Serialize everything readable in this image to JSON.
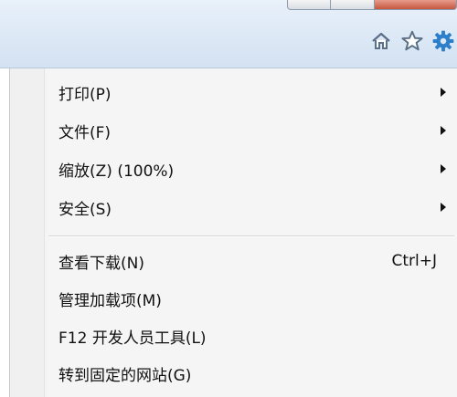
{
  "menu": {
    "items": [
      {
        "label": "打印(P)",
        "submenu": true
      },
      {
        "label": "文件(F)",
        "submenu": true
      },
      {
        "label": "缩放(Z) (100%)",
        "submenu": true
      },
      {
        "label": "安全(S)",
        "submenu": true
      }
    ],
    "items2": [
      {
        "label": "查看下载(N)",
        "shortcut": "Ctrl+J"
      },
      {
        "label": "管理加载项(M)"
      },
      {
        "label": "F12 开发人员工具(L)"
      },
      {
        "label": "转到固定的网站(G)"
      }
    ]
  },
  "toolbar": {
    "icons": [
      "home-icon",
      "favorites-star-icon",
      "tools-gear-icon"
    ],
    "accent": "#2d7fc9"
  }
}
